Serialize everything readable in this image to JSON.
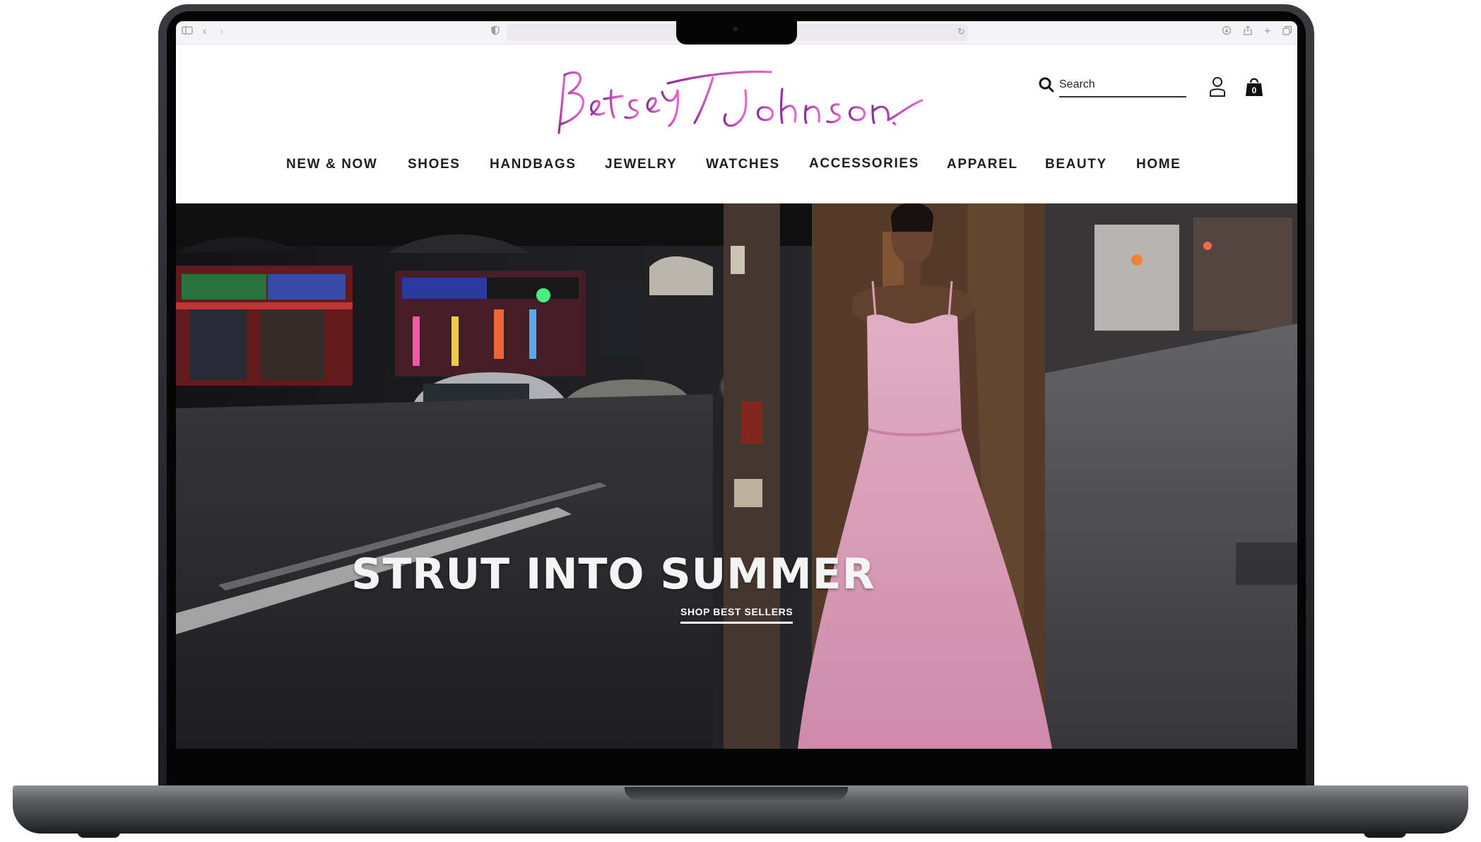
{
  "site": {
    "brand": "Betsey Johnson",
    "colors": {
      "logo_pink": "#d84fbf",
      "logo_purple": "#7a2a8e",
      "nav_text": "#1e1e1e",
      "dress_pink": "#e9a6c4"
    }
  },
  "header": {
    "search": {
      "placeholder": "Search",
      "icon": "search-icon"
    },
    "account_icon": "account-icon",
    "bag": {
      "icon": "shopping-bag-icon",
      "count": "0"
    }
  },
  "nav": {
    "items": [
      "NEW & NOW",
      "SHOES",
      "HANDBAGS",
      "JEWELRY",
      "WATCHES",
      "ACCESSORIES",
      "APPAREL",
      "BEAUTY",
      "HOME"
    ]
  },
  "hero": {
    "headline": "STRUT INTO SUMMER",
    "cta": "SHOP BEST SELLERS"
  },
  "browser": {
    "icons": [
      "sidebar-icon",
      "back-icon",
      "forward-icon",
      "shield-icon",
      "reload-icon",
      "download-icon",
      "share-icon",
      "new-tab-icon",
      "tabs-icon"
    ]
  }
}
